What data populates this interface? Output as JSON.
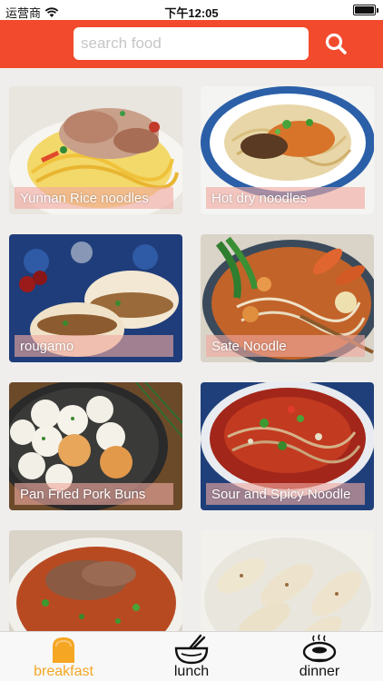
{
  "status_bar": {
    "carrier": "运营商",
    "time": "下午12:05"
  },
  "search": {
    "placeholder": "search food",
    "value": ""
  },
  "foods": [
    {
      "name": "Yunnan Rice noodles"
    },
    {
      "name": "Hot dry noodles"
    },
    {
      "name": "rougamo"
    },
    {
      "name": "Sate Noodle"
    },
    {
      "name": "Pan Fried Pork Buns"
    },
    {
      "name": "Sour and Spicy Noodle"
    },
    {
      "name": ""
    },
    {
      "name": ""
    }
  ],
  "tabs": [
    {
      "label": "breakfast",
      "icon": "toast-icon",
      "active": true
    },
    {
      "label": "lunch",
      "icon": "bowl-chopsticks-icon",
      "active": false
    },
    {
      "label": "dinner",
      "icon": "soup-bowl-icon",
      "active": false
    }
  ],
  "colors": {
    "header": "#f24a2d",
    "active_tab": "#f5a623",
    "background": "#efeeec"
  }
}
